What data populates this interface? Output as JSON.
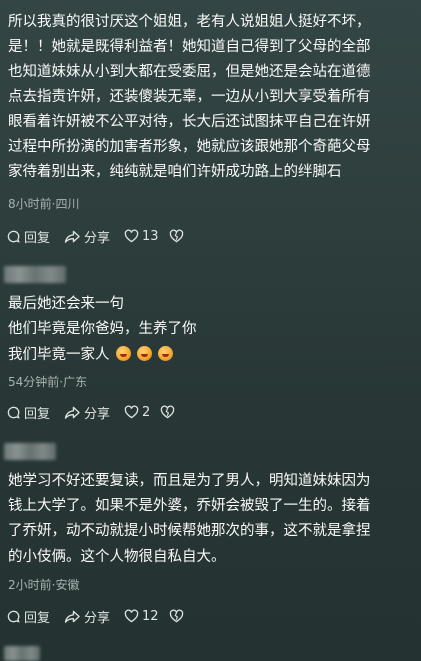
{
  "comments": [
    {
      "lines": [
        "所以我真的很讨厌这个姐姐，老有人说姐姐人挺好不坏，",
        "是！！她就是既得利益者！她知道自己得到了父母的全部",
        "也知道妹妹从小到大都在受委屈，但是她还是会站在道德",
        "点去指责许妍，还装傻装无辜，一边从小到大享受着所有",
        "眼看着许妍被不公平对待，长大后还试图抹平自己在许妍",
        "过程中所扮演的加害者形象，她就应该跟她那个奇葩父母",
        "家待着别出来，纯纯就是咱们许妍成功路上的绊脚石"
      ],
      "meta": "8小时前·四川",
      "like_count": "13"
    },
    {
      "lines": [
        "最后她还会来一句",
        "他们毕竟是你爸妈，生养了你",
        "我们毕竟一家人"
      ],
      "meta": "54分钟前·广东",
      "like_count": "2"
    },
    {
      "lines": [
        "她学习不好还要复读，而且是为了男人，明知道妹妹因为",
        "钱上大学了。如果不是外婆，乔妍会被毁了一生的。接着",
        "了乔妍，动不动就提小时候帮她那次的事，这不就是拿捏",
        "的小伎俩。这个人物很自私自大。"
      ],
      "meta": "2小时前·安徽",
      "like_count": "12"
    }
  ],
  "actions": {
    "reply": "回复",
    "share": "分享"
  }
}
